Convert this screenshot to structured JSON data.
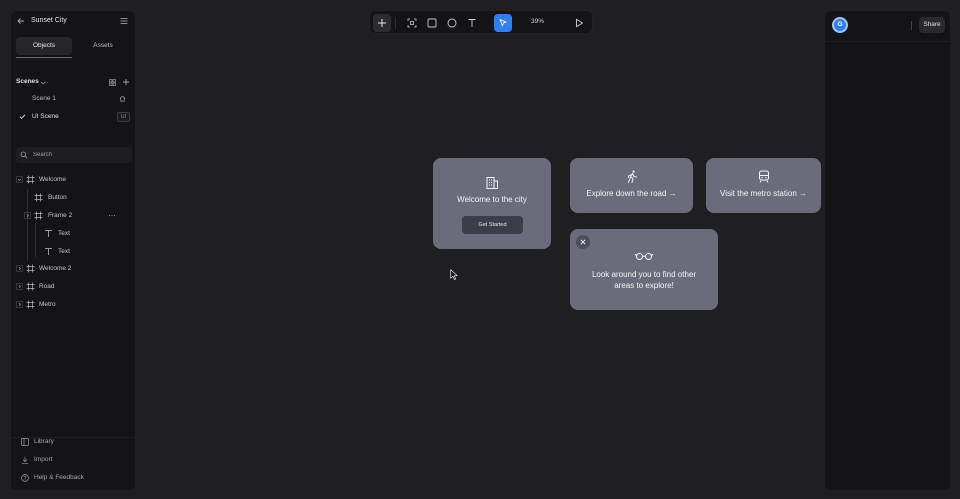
{
  "project": {
    "title": "Sunset City"
  },
  "tabs": [
    {
      "label": "Objects"
    },
    {
      "label": "Assets"
    }
  ],
  "scenes": {
    "label": "Scenes",
    "items": [
      {
        "label": "Scene 1"
      },
      {
        "label": "UI Scene",
        "badge": "UI"
      }
    ]
  },
  "search": {
    "placeholder": "Search"
  },
  "layers": [
    {
      "label": "Welcome"
    },
    {
      "label": "Button"
    },
    {
      "label": "Frame 2"
    },
    {
      "label": "Text"
    },
    {
      "label": "Text"
    },
    {
      "label": "Welcome 2"
    },
    {
      "label": "Road"
    },
    {
      "label": "Metro"
    }
  ],
  "footer": {
    "library": "Library",
    "import": "Import",
    "help": "Help & Feedback"
  },
  "toolbar": {
    "zoom": "39%"
  },
  "user": {
    "initial": "G"
  },
  "share": {
    "label": "Share"
  },
  "cards": {
    "welcome": {
      "title": "Welcome to the city",
      "button": "Get Started"
    },
    "road": {
      "title": "Explore down the road →"
    },
    "metro": {
      "title": "Visit the metro station →"
    },
    "explore": {
      "title": "Look around you to find other areas to explore!"
    }
  },
  "colors": {
    "accent": "#2f7ff6",
    "card": "#6b6b79",
    "canvas": "#1f1f22",
    "panel": "#141416"
  }
}
